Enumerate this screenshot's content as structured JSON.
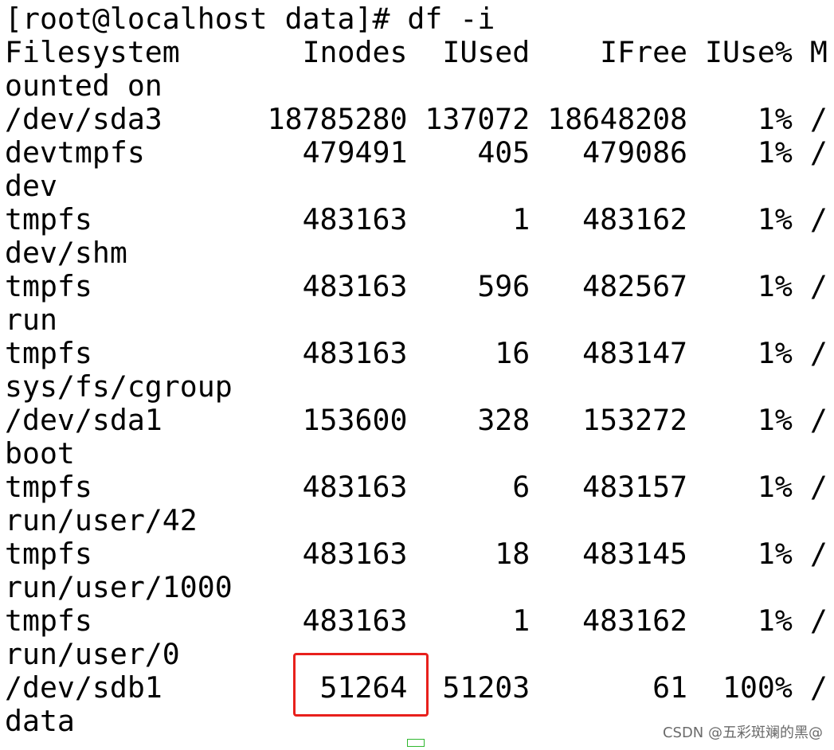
{
  "terminal": {
    "prompt_line": "[root@localhost data]# df -i",
    "header_line": "Filesystem       Inodes  IUsed    IFree IUse% M",
    "header_wrap": "ounted on",
    "rows": [
      {
        "line": "/dev/sda3      18785280 137072 18648208    1% /",
        "wrap": ""
      },
      {
        "line": "devtmpfs         479491    405   479086    1% /",
        "wrap": "dev"
      },
      {
        "line": "tmpfs            483163      1   483162    1% /",
        "wrap": "dev/shm"
      },
      {
        "line": "tmpfs            483163    596   482567    1% /",
        "wrap": "run"
      },
      {
        "line": "tmpfs            483163     16   483147    1% /",
        "wrap": "sys/fs/cgroup"
      },
      {
        "line": "/dev/sda1        153600    328   153272    1% /",
        "wrap": "boot"
      },
      {
        "line": "tmpfs            483163      6   483157    1% /",
        "wrap": "run/user/42"
      },
      {
        "line": "tmpfs            483163     18   483145    1% /",
        "wrap": "run/user/1000"
      },
      {
        "line": "tmpfs            483163      1   483162    1% /",
        "wrap": "run/user/0"
      },
      {
        "line": "/dev/sdb1         51264  51203       61  100% /",
        "wrap": "data"
      }
    ]
  },
  "watermark": "CSDN @五彩斑斓的黑@",
  "colors": {
    "highlight_box": "#e8201c",
    "cursor": "#2fb82f",
    "text": "#000000",
    "background": "#ffffff"
  }
}
